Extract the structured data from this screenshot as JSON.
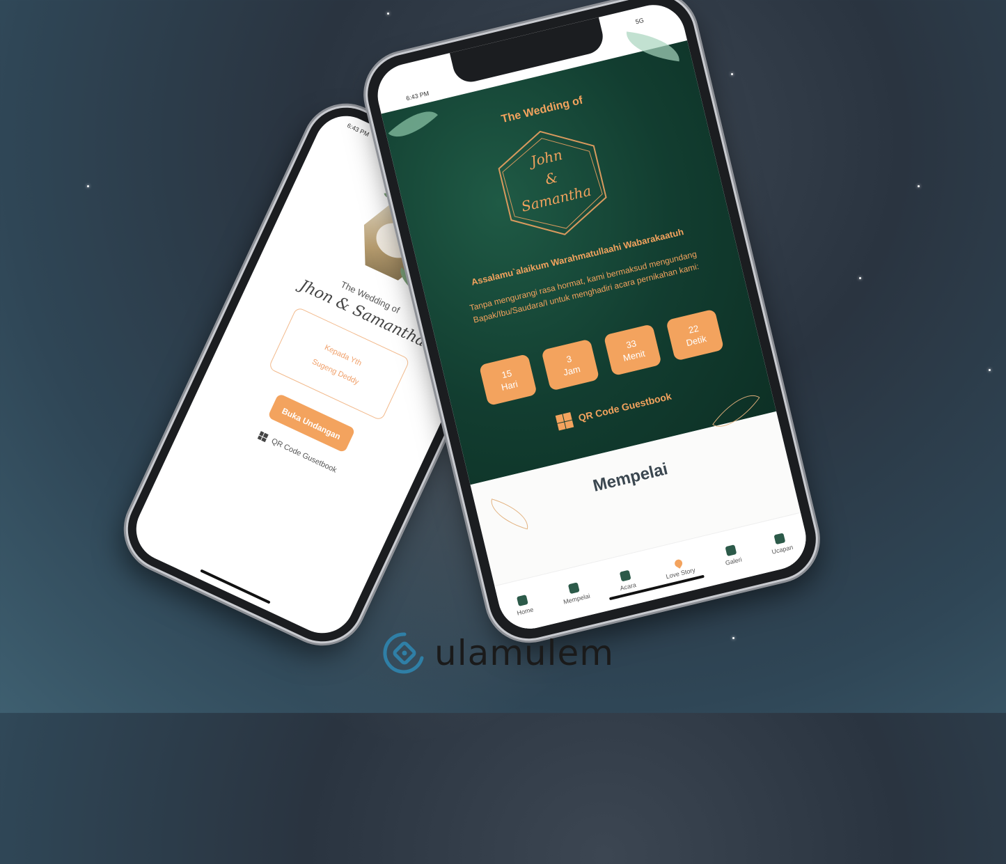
{
  "back_phone": {
    "status_time": "6:43 PM",
    "title": "The Wedding of",
    "names": "Jhon & Samantha",
    "recipient_label": "Kepada Yth",
    "recipient_name": "Sugeng Deddy",
    "open_button": "Buka Undangan",
    "qr_link": "QR Code Gusetbook"
  },
  "front_phone": {
    "status_time": "6:43 PM",
    "status_network": "5G",
    "title": "The Wedding of",
    "name_1": "John",
    "ampersand": "&",
    "name_2": "Samantha",
    "salam": "Assalamu`alaikum Warahmatullaahi Wabarakaatuh",
    "message": "Tanpa mengurangi rasa hormat, kami bermaksud mengundang Bapak/Ibu/Saudara/I untuk menghadiri acara pernikahan kami:",
    "countdown": [
      {
        "value": "15",
        "unit": "Hari"
      },
      {
        "value": "3",
        "unit": "Jam"
      },
      {
        "value": "33",
        "unit": "Menit"
      },
      {
        "value": "22",
        "unit": "Detik"
      }
    ],
    "qr_link": "QR Code Guestbook",
    "section_title": "Mempelai",
    "nav": [
      {
        "label": "Home",
        "icon": "home-icon"
      },
      {
        "label": "Mempelai",
        "icon": "couple-icon"
      },
      {
        "label": "Acara",
        "icon": "calendar-icon"
      },
      {
        "label": "Love Story",
        "icon": "heart-icon"
      },
      {
        "label": "Galeri",
        "icon": "gallery-icon"
      },
      {
        "label": "Ucapan",
        "icon": "envelope-icon"
      }
    ],
    "colors": {
      "green": "#123d30",
      "accent": "#f3a35e"
    }
  },
  "logo": {
    "text": "ulamulem",
    "color": "#1a1a1a",
    "mark_color": "#2f7fa6"
  }
}
